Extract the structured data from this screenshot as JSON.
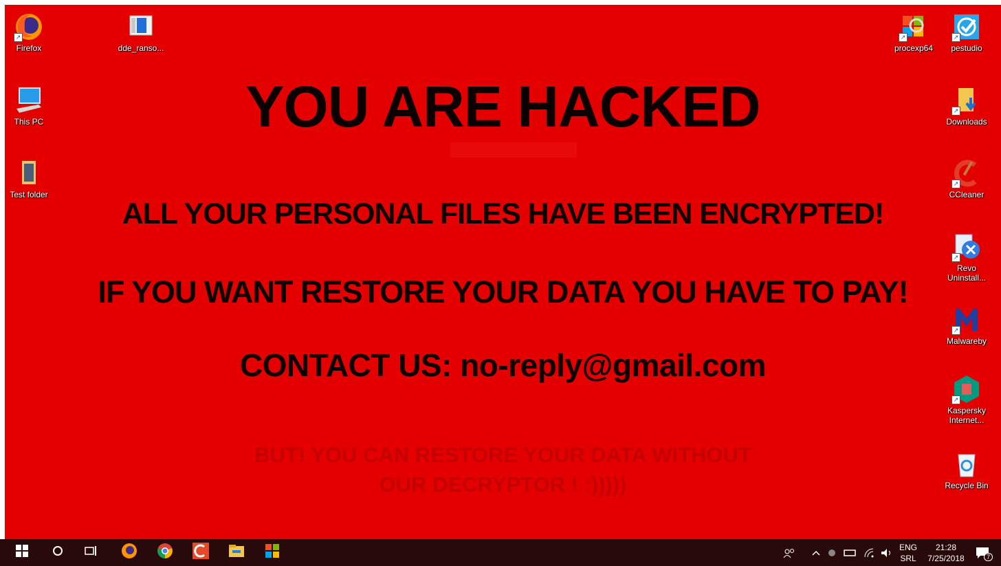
{
  "ransom_note": {
    "title": "YOU ARE HACKED",
    "line1": "ALL YOUR PERSONAL FILES HAVE BEEN ENCRYPTED!",
    "line2": "IF YOU WANT RESTORE YOUR DATA YOU HAVE TO PAY!",
    "line3": "CONTACT US: no-reply@gmail.com",
    "faint_line1": "BUT! YOU CAN  RESTORE YOUR DATA WITHOUT",
    "faint_line2": "OUR DECRYPTOR ! :)))))",
    "background_color": "#e50000"
  },
  "desktop_icons_left": [
    {
      "label": "Firefox",
      "icon": "firefox-icon"
    },
    {
      "label": "This PC",
      "icon": "computer-icon"
    },
    {
      "label": "Test folder",
      "icon": "folder-icon"
    }
  ],
  "desktop_icons_top": [
    {
      "label": "dde_ranso...",
      "icon": "document-window-icon"
    }
  ],
  "desktop_icons_right": [
    {
      "label": "procexp64",
      "icon": "process-explorer-icon"
    },
    {
      "label": "pestudio",
      "icon": "pestudio-icon"
    },
    {
      "label": "Downloads",
      "icon": "downloads-folder-icon"
    },
    {
      "label": "CCleaner",
      "icon": "ccleaner-icon"
    },
    {
      "label": "Revo Uninstall...",
      "icon": "revo-uninstaller-icon"
    },
    {
      "label": "Malwareby",
      "icon": "malwarebytes-icon"
    },
    {
      "label": "Kaspersky Internet...",
      "icon": "kaspersky-icon"
    },
    {
      "label": "Recycle Bin",
      "icon": "recycle-bin-icon"
    }
  ],
  "taskbar": {
    "background_color": "#290a0a",
    "pinned": [
      "start-icon",
      "search-icon",
      "task-view-icon",
      "firefox-icon",
      "chrome-icon",
      "ccleaner-icon",
      "file-explorer-icon",
      "process-explorer-icon"
    ],
    "tray": {
      "language_top": "ENG",
      "language_bottom": "SRL",
      "time": "21:28",
      "date": "7/25/2018",
      "notification_count": "7"
    }
  }
}
